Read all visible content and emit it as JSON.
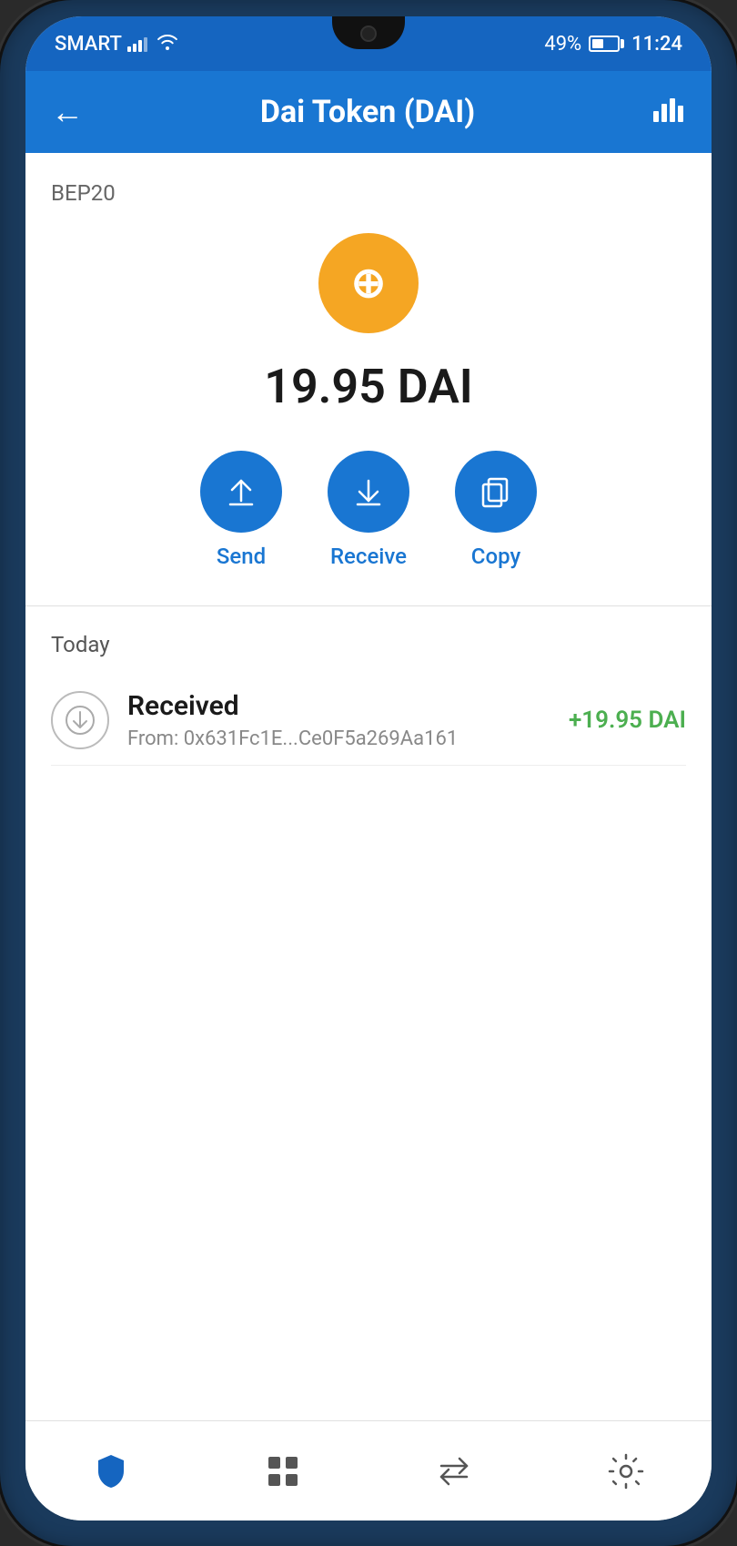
{
  "statusBar": {
    "carrier": "SMART",
    "battery": "49%",
    "time": "11:24"
  },
  "header": {
    "title": "Dai Token (DAI)",
    "backLabel": "←",
    "chartLabel": "chart"
  },
  "token": {
    "type": "BEP20",
    "balance": "19.95 DAI"
  },
  "actions": [
    {
      "id": "send",
      "label": "Send"
    },
    {
      "id": "receive",
      "label": "Receive"
    },
    {
      "id": "copy",
      "label": "Copy"
    }
  ],
  "transactions": {
    "dateLabel": "Today",
    "items": [
      {
        "type": "Received",
        "from": "From: 0x631Fc1E...Ce0F5a269Aa161",
        "amount": "+19.95 DAI"
      }
    ]
  },
  "bottomNav": [
    {
      "id": "shield",
      "label": "Security"
    },
    {
      "id": "grid",
      "label": "Wallet"
    },
    {
      "id": "swap",
      "label": "Swap"
    },
    {
      "id": "settings",
      "label": "Settings"
    }
  ],
  "colors": {
    "primary": "#1976d2",
    "headerBg": "#1976d2",
    "daiOrange": "#f5a623",
    "received": "#4caf50",
    "navActive": "#1565c0"
  }
}
